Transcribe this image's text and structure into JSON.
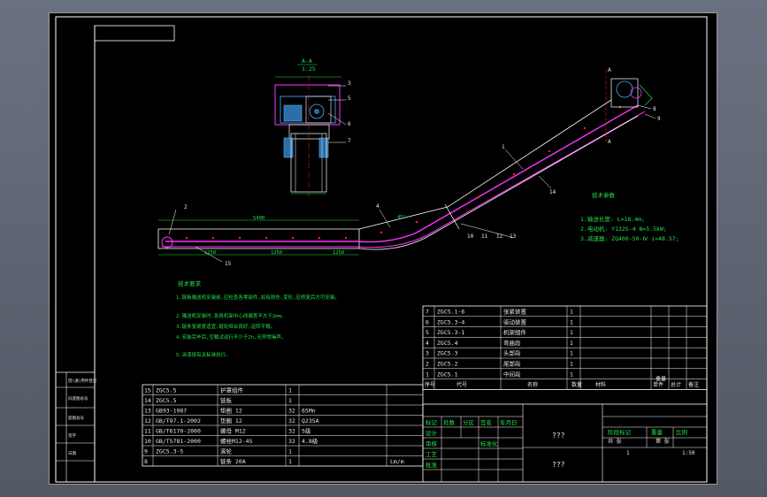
{
  "section_view": {
    "title": "A-A",
    "scale": "1:25"
  },
  "tech_params": {
    "title": "技术参数",
    "lines": [
      "1.输送长度: L=18.4m;",
      "2.电动机: Y132S-4 N=5.5kW;",
      "3.减速器: ZQ400-50-Ⅳ i=48.57;"
    ]
  },
  "notes": {
    "title": "技术要求",
    "lines": [
      "1.链板输送机安装前,应检查各零部件,如有损伤,变形,应修复后方可安装。",
      "2.输送机安装时,各段机架中心线偏差不大于2mm。",
      "3.链条张紧度适宜,链轮啮合良好,运转平稳。",
      "4.安装完毕后,空载试运行不少于2h,无异常噪声。",
      "5.涂漆按有关标准执行。"
    ]
  },
  "callouts": [
    "1",
    "2",
    "3",
    "4",
    "5",
    "6",
    "7",
    "8",
    "9",
    "10",
    "11",
    "12",
    "13",
    "14",
    "15"
  ],
  "dims": {
    "upper_len": "5400",
    "lower_seg1": "1250",
    "lower_seg2": "1250",
    "lower_seg3": "1250",
    "angle": "45°",
    "width": "600"
  },
  "upper_bom": [
    [
      "7",
      "ZGC5.1-6",
      "张紧装置",
      "1",
      ""
    ],
    [
      "6",
      "ZGC5.3-4",
      "驱动装置",
      "1",
      ""
    ],
    [
      "5",
      "ZGC5.3-1",
      "机架组件",
      "1",
      ""
    ],
    [
      "4",
      "ZGC5.4",
      "弯曲段",
      "1",
      ""
    ],
    [
      "3",
      "ZGC5.3",
      "头部段",
      "1",
      ""
    ],
    [
      "2",
      "ZGC5.2",
      "尾部段",
      "1",
      ""
    ],
    [
      "1",
      "ZGC5.1",
      "中间段",
      "1",
      ""
    ]
  ],
  "upper_bom_header": [
    "序号",
    "代号",
    "名称",
    "数量",
    "材料",
    "单件",
    "总计",
    "备注"
  ],
  "upper_bom_weight": "重量",
  "lower_bom": [
    [
      "15",
      "ZGC5.5",
      "护罩组件",
      "1",
      "",
      ""
    ],
    [
      "14",
      "ZGC5.5",
      "链板",
      "1",
      "",
      ""
    ],
    [
      "13",
      "GB93-1987",
      "垫圈 12",
      "32",
      "65Mn",
      ""
    ],
    [
      "12",
      "GB/T97.1-2002",
      "垫圈 12",
      "32",
      "Q235A",
      ""
    ],
    [
      "11",
      "GB/T6170-2000",
      "螺母 M12",
      "32",
      "5级",
      ""
    ],
    [
      "10",
      "GB/T5781-2000",
      "螺栓M12-45",
      "32",
      "4.8级",
      ""
    ],
    [
      "9",
      "ZGC5.3-5",
      "滚轮",
      "1",
      "",
      ""
    ],
    [
      "8",
      "",
      "链条 20A",
      "1",
      "",
      "Lm/m"
    ]
  ],
  "title_block": {
    "rows": [
      "标记",
      "设计",
      "审核",
      "工艺",
      "批准"
    ],
    "cols": [
      "处数",
      "分区",
      "更改文件号",
      "签名",
      "年月日"
    ],
    "standard": "标准化",
    "drawing_name": "???",
    "drawing_no": "???",
    "stage_label": "阶段标记",
    "weight_label": "重量",
    "scale_label": "比例",
    "sheets": "1",
    "scale": "1:50",
    "page_a": "共 张",
    "page_b": "第 张"
  },
  "side_stamps": [
    "借(通)用件登记",
    "旧底图总号",
    "底图总号",
    "签字",
    "日期"
  ],
  "colors": {
    "frame": "#ffffff",
    "chain": "#ff33ff",
    "dim": "#22e04a",
    "hidden": "#ff2222",
    "detail": "#4fb0ff",
    "text": "#e8e8e8"
  }
}
